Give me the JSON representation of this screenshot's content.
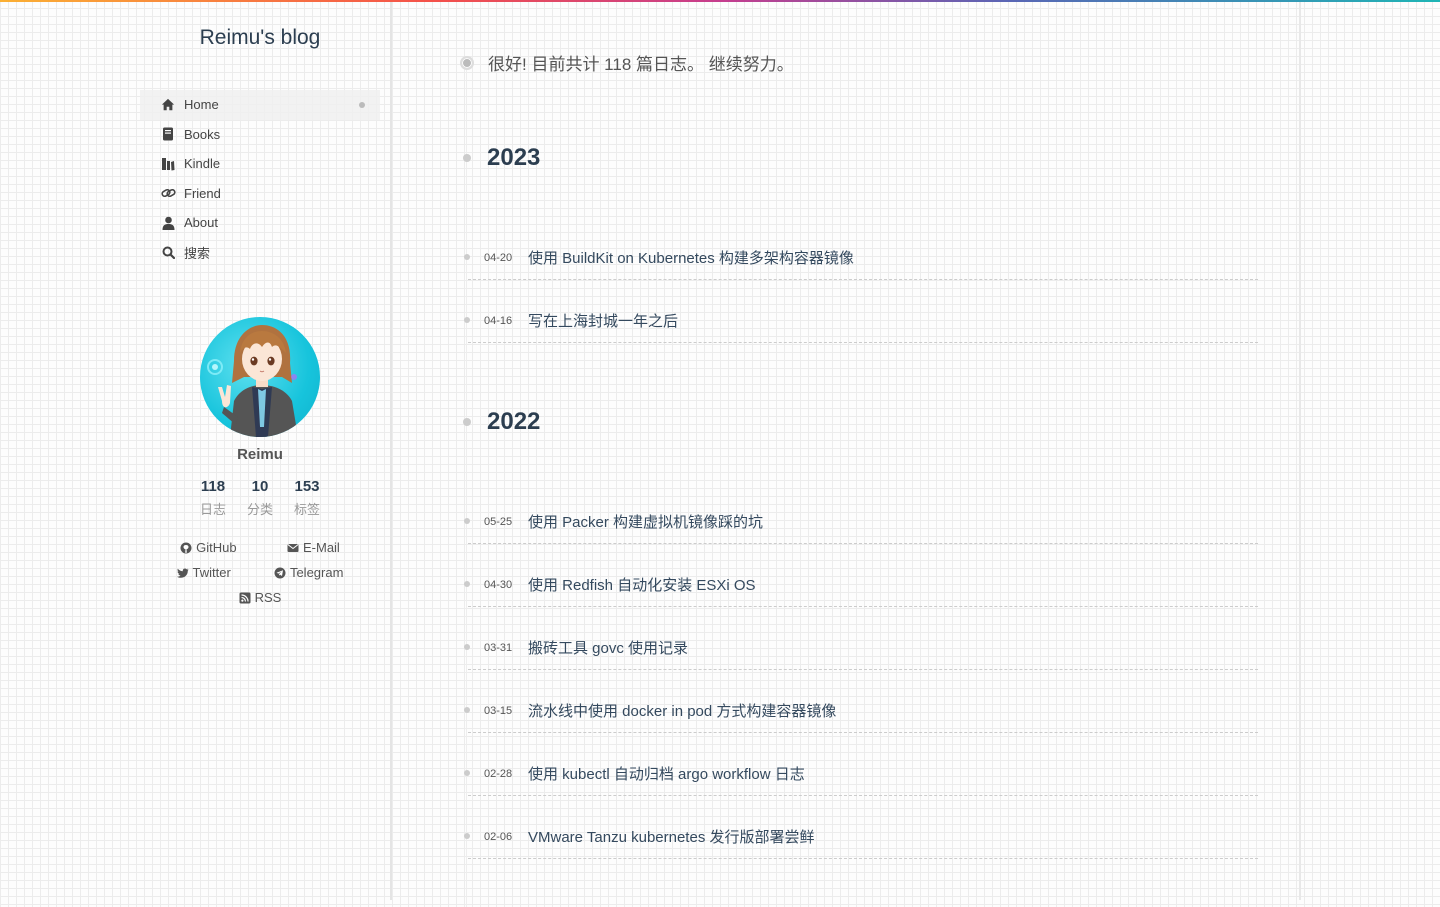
{
  "site": {
    "title": "Reimu's blog"
  },
  "nav": [
    {
      "label": "Home",
      "icon": "home-icon",
      "active": true
    },
    {
      "label": "Books",
      "icon": "book-icon"
    },
    {
      "label": "Kindle",
      "icon": "kindle-icon"
    },
    {
      "label": "Friend",
      "icon": "link-icon"
    },
    {
      "label": "About",
      "icon": "user-icon"
    },
    {
      "label": "搜索",
      "icon": "search-icon"
    }
  ],
  "author": {
    "name": "Reimu",
    "stats": [
      {
        "num": "118",
        "label": "日志"
      },
      {
        "num": "10",
        "label": "分类"
      },
      {
        "num": "153",
        "label": "标签"
      }
    ],
    "links": [
      {
        "label": "GitHub",
        "icon": "github-icon"
      },
      {
        "label": "E-Mail",
        "icon": "envelope-icon"
      },
      {
        "label": "Twitter",
        "icon": "twitter-icon"
      },
      {
        "label": "Telegram",
        "icon": "telegram-icon"
      },
      {
        "label": "RSS",
        "icon": "rss-icon"
      }
    ]
  },
  "archive": {
    "intro": "很好! 目前共计 118 篇日志。 继续努力。",
    "years": [
      {
        "year": "2023",
        "posts": [
          {
            "date": "04-20",
            "title": "使用 BuildKit on Kubernetes 构建多架构容器镜像"
          },
          {
            "date": "04-16",
            "title": "写在上海封城一年之后"
          }
        ]
      },
      {
        "year": "2022",
        "posts": [
          {
            "date": "05-25",
            "title": "使用 Packer 构建虚拟机镜像踩的坑"
          },
          {
            "date": "04-30",
            "title": "使用 Redfish 自动化安装 ESXi OS"
          },
          {
            "date": "03-31",
            "title": "搬砖工具 govc 使用记录"
          },
          {
            "date": "03-15",
            "title": "流水线中使用 docker in pod 方式构建容器镜像"
          },
          {
            "date": "02-28",
            "title": "使用 kubectl 自动归档 argo workflow 日志"
          },
          {
            "date": "02-06",
            "title": "VMware Tanzu kubernetes 发行版部署尝鲜"
          }
        ]
      }
    ]
  },
  "colors": {
    "accent": "#2c3e50",
    "text": "#333333",
    "muted": "#999999"
  }
}
